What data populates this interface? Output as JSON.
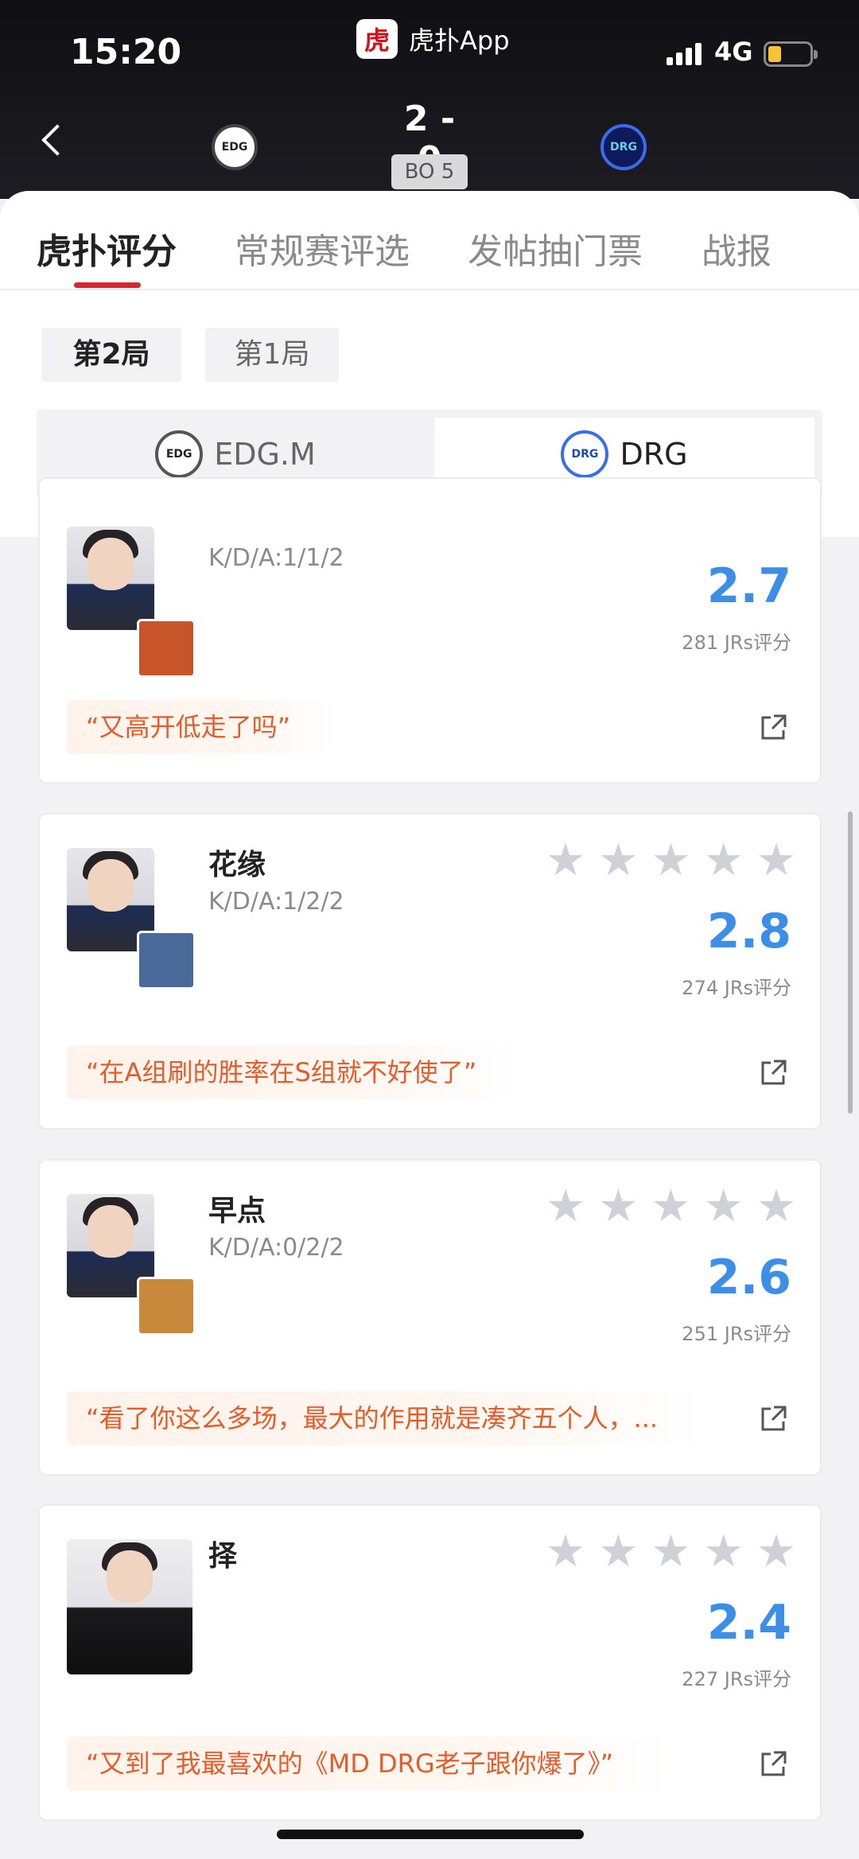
{
  "status": {
    "time": "15:20",
    "app_name": "虎扑App",
    "app_logo_glyph": "虎",
    "network": "4G"
  },
  "match": {
    "score": "2 - 0",
    "format": "BO 5",
    "team_left_logo": "EDG",
    "team_right_logo": "DRG"
  },
  "tabs": [
    {
      "label": "虎扑评分",
      "active": true
    },
    {
      "label": "常规赛评选",
      "active": false
    },
    {
      "label": "发帖抽门票",
      "active": false
    },
    {
      "label": "战报",
      "active": false
    }
  ],
  "games": [
    {
      "label": "第2局",
      "active": true
    },
    {
      "label": "第1局",
      "active": false
    }
  ],
  "teams": [
    {
      "name": "EDG.M",
      "logo": "EDG",
      "active": false
    },
    {
      "name": "DRG",
      "logo": "DRG",
      "active": true
    }
  ],
  "players": [
    {
      "name": "",
      "kda": "K/D/A:1/1/2",
      "rating": "2.7",
      "votes": "281 JRs评分",
      "quote": "“又高开低走了吗”",
      "hero_color": "#c8552a"
    },
    {
      "name": "花缘",
      "kda": "K/D/A:1/2/2",
      "rating": "2.8",
      "votes": "274 JRs评分",
      "quote": "“在A组刷的胜率在S组就不好使了”",
      "hero_color": "#4a6a9a"
    },
    {
      "name": "早点",
      "kda": "K/D/A:0/2/2",
      "rating": "2.6",
      "votes": "251 JRs评分",
      "quote": "“看了你这么多场，最大的作用就是凑齐五个人，...",
      "hero_color": "#c88a3a"
    },
    {
      "name": "择",
      "kda": "",
      "rating": "2.4",
      "votes": "227 JRs评分",
      "quote": "“又到了我最喜欢的《MD DRG老子跟你爆了》”",
      "hero_color": ""
    }
  ],
  "icons": {
    "star": "star-icon",
    "share": "share-icon",
    "back": "back-arrow-icon"
  },
  "colors": {
    "accent": "#d8262f",
    "rating": "#3c8ee6",
    "quote_text": "#e45c2a",
    "star_empty": "#cfd0d8"
  }
}
